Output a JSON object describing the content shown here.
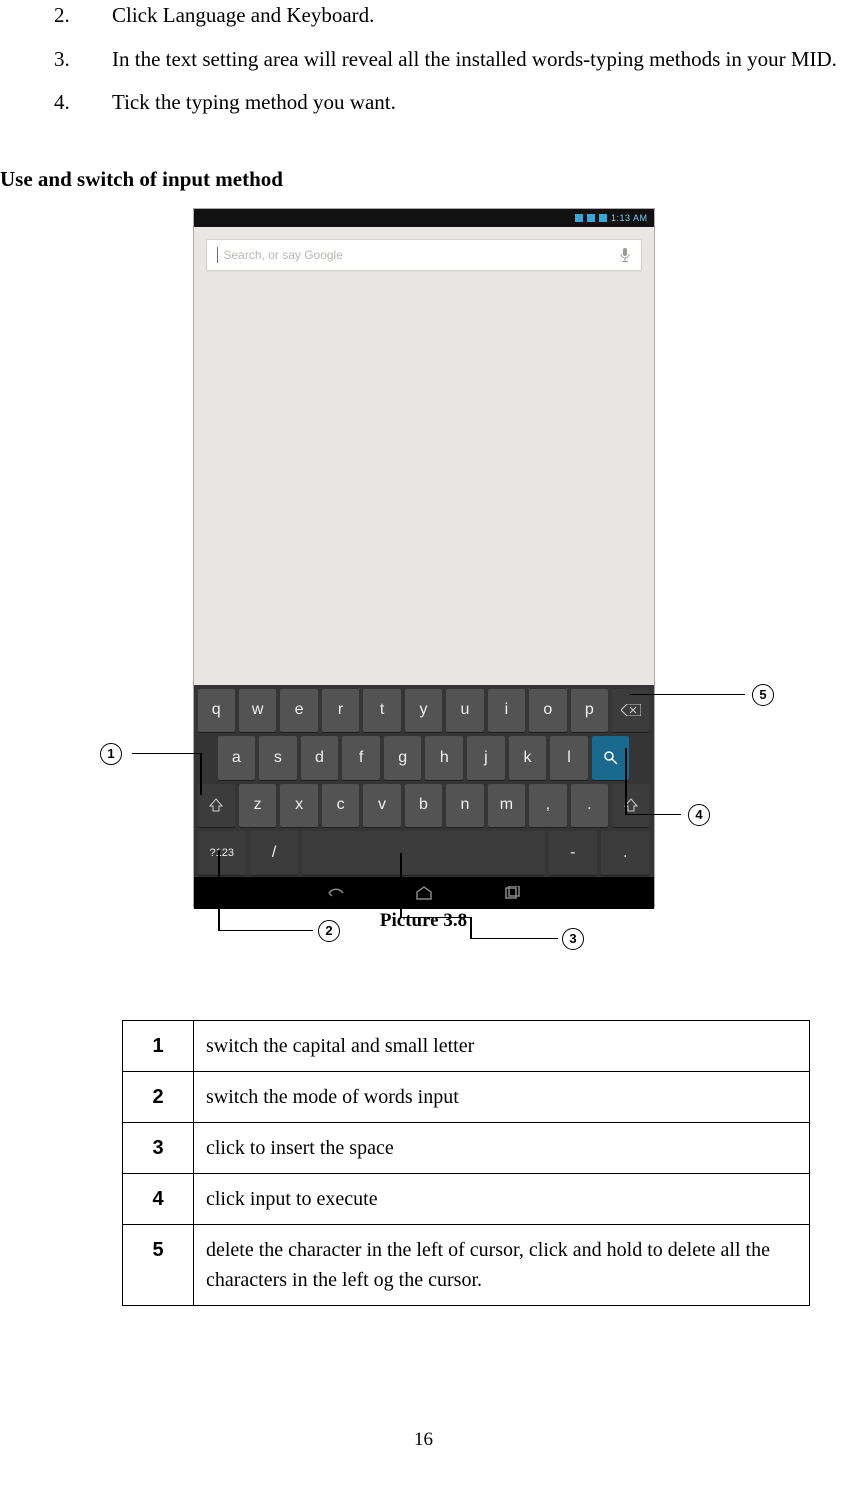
{
  "list": {
    "item2": {
      "n": "2.",
      "t": "Click Language and Keyboard."
    },
    "item3": {
      "n": "3.",
      "t": "In the text setting area will reveal all the installed words-typing methods in your MID."
    },
    "item4": {
      "n": "4.",
      "t": "Tick the typing method you want."
    }
  },
  "section_title": "Use and switch of input method",
  "screenshot": {
    "status_time": "1:13 AM",
    "search_placeholder": "Search, or say Google",
    "keys": {
      "row1": [
        "q",
        "w",
        "e",
        "r",
        "t",
        "y",
        "u",
        "i",
        "o",
        "p"
      ],
      "row2": [
        "a",
        "s",
        "d",
        "f",
        "g",
        "h",
        "j",
        "k",
        "l"
      ],
      "row3": [
        "z",
        "x",
        "c",
        "v",
        "b",
        "n",
        "m",
        ",",
        "."
      ],
      "mode_key": "?123",
      "slash_key": "/",
      "dash_key": "-",
      "dot_key": "."
    }
  },
  "caption": "Picture 3.8",
  "callouts": {
    "c1": "1",
    "c2": "2",
    "c3": "3",
    "c4": "4",
    "c5": "5"
  },
  "legend": {
    "r1": {
      "n": "1",
      "t": "switch the capital and small letter"
    },
    "r2": {
      "n": "2",
      "t": "switch the mode of words input"
    },
    "r3": {
      "n": "3",
      "t": "click to insert the space"
    },
    "r4": {
      "n": "4",
      "t": "click input to execute"
    },
    "r5": {
      "n": "5",
      "t": "delete the character in the left of cursor, click and hold to delete all the characters in the left og the cursor."
    }
  },
  "page_number": "16"
}
